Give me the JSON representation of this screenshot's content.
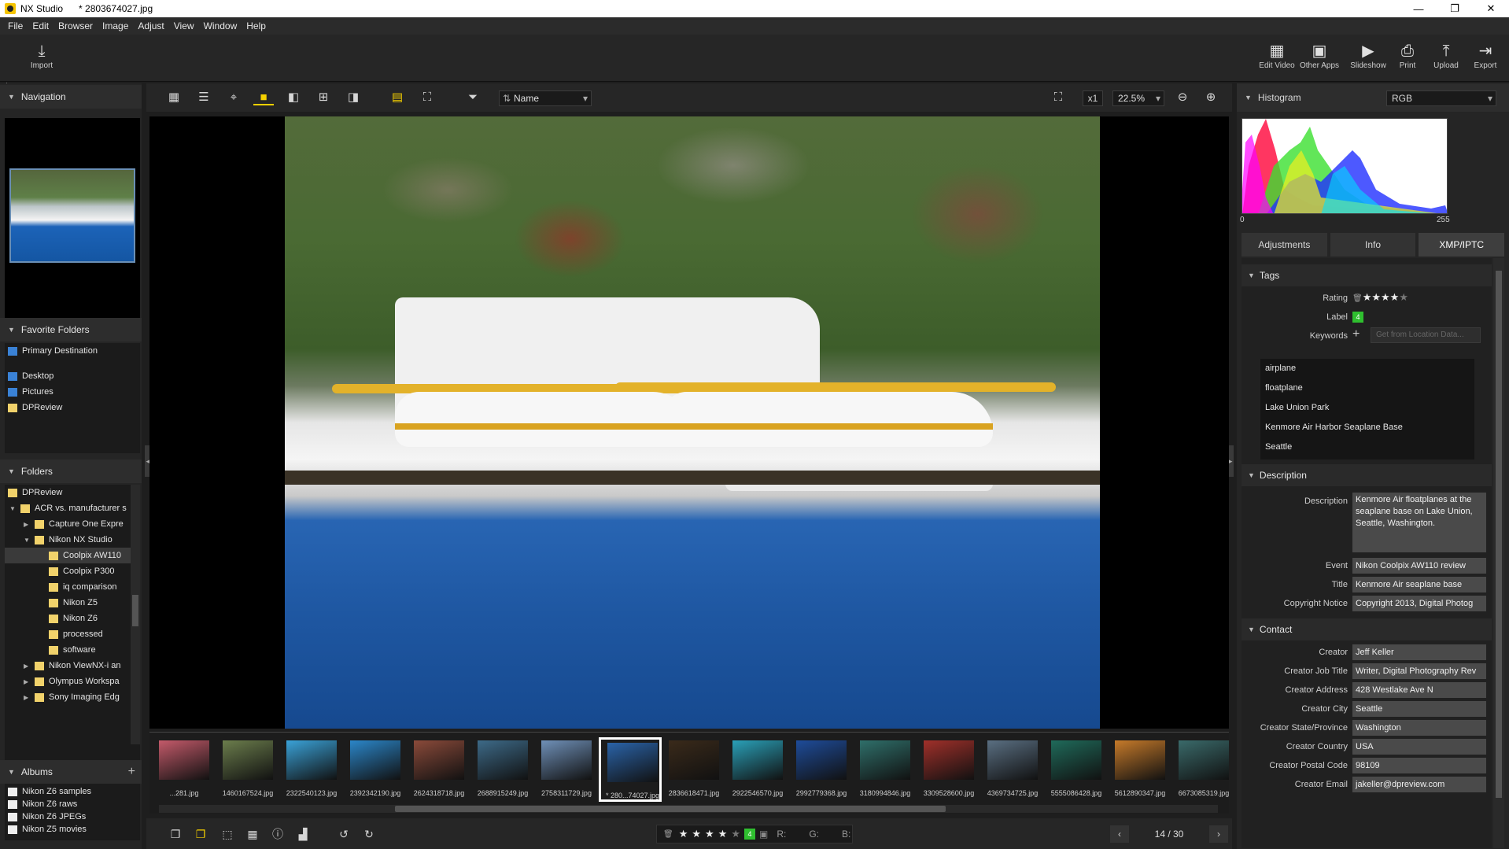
{
  "titlebar": {
    "app": "NX Studio",
    "document": "* 2803674027.jpg",
    "minimize": "—",
    "restore": "❐",
    "close": "✕"
  },
  "menu": [
    "File",
    "Edit",
    "Browser",
    "Image",
    "Adjust",
    "View",
    "Window",
    "Help"
  ],
  "toolbar": {
    "import": "Import",
    "right": [
      "Edit Video",
      "Other Apps",
      "Slideshow",
      "Print",
      "Upload",
      "Export"
    ]
  },
  "navigation": {
    "title": "Navigation"
  },
  "favorites": {
    "title": "Favorite Folders",
    "items": [
      "Primary Destination",
      "Desktop",
      "Pictures",
      "DPReview"
    ]
  },
  "folders": {
    "title": "Folders",
    "items": [
      "DPReview",
      "ACR vs. manufacturer s",
      "Capture One Expre",
      "Nikon NX Studio",
      "Coolpix AW110",
      "Coolpix P300",
      "iq comparison",
      "Nikon Z5",
      "Nikon Z6",
      "processed",
      "software",
      "Nikon ViewNX-i an",
      "Olympus Workspa",
      "Sony Imaging Edg"
    ]
  },
  "albums": {
    "title": "Albums",
    "items": [
      "Nikon Z6 samples",
      "Nikon Z6 raws",
      "Nikon Z6 JPEGs",
      "Nikon Z5 movies"
    ]
  },
  "viewbar": {
    "sort": "Name",
    "x1": "x1",
    "zoom": "22.5%"
  },
  "filmstrip": [
    {
      "name": "...281.jpg",
      "color": "#c45a6a"
    },
    {
      "name": "1460167524.jpg",
      "color": "#6b7d4c"
    },
    {
      "name": "2322540123.jpg",
      "color": "#3aa2d8"
    },
    {
      "name": "2392342190.jpg",
      "color": "#2b86c9"
    },
    {
      "name": "2624318718.jpg",
      "color": "#8a4a3a"
    },
    {
      "name": "2688915249.jpg",
      "color": "#3d6a88"
    },
    {
      "name": "2758311729.jpg",
      "color": "#6f90b8"
    },
    {
      "name": "* 280...74027.jpg",
      "color": "#2a63a8"
    },
    {
      "name": "2836618471.jpg",
      "color": "#3a2a1a"
    },
    {
      "name": "2922546570.jpg",
      "color": "#2aa0b8"
    },
    {
      "name": "2992779368.jpg",
      "color": "#1e4c9a"
    },
    {
      "name": "3180994846.jpg",
      "color": "#2f6f6a"
    },
    {
      "name": "3309528600.jpg",
      "color": "#a0302a"
    },
    {
      "name": "4369734725.jpg",
      "color": "#5a6f82"
    },
    {
      "name": "5555086428.jpg",
      "color": "#1f6a5a"
    },
    {
      "name": "5612890347.jpg",
      "color": "#c67a2a"
    },
    {
      "name": "6673085319.jpg",
      "color": "#3a6a6a"
    }
  ],
  "bottombar": {
    "label_num": "4",
    "r": "R:",
    "g": "G:",
    "b": "B:",
    "page": "14 / 30"
  },
  "histogram": {
    "title": "Histogram",
    "channel": "RGB",
    "min": "0",
    "max": "255"
  },
  "tabs": [
    "Adjustments",
    "Info",
    "XMP/IPTC"
  ],
  "tags": {
    "title": "Tags",
    "rating_label": "Rating",
    "rating": 4,
    "label_label": "Label",
    "label_value": "4",
    "keywords_label": "Keywords",
    "keywords_button": "Get from Location Data...",
    "keywords": [
      "airplane",
      "floatplane",
      "Lake Union Park",
      "Kenmore Air Harbor Seaplane Base",
      "Seattle"
    ]
  },
  "description": {
    "title": "Description",
    "fields": [
      {
        "label": "Description",
        "value": "Kenmore Air floatplanes at the seaplane base on Lake Union, Seattle, Washington."
      },
      {
        "label": "Event",
        "value": "Nikon Coolpix AW110 review"
      },
      {
        "label": "Title",
        "value": "Kenmore Air seaplane base"
      },
      {
        "label": "Copyright Notice",
        "value": "Copyright 2013, Digital Photog"
      }
    ]
  },
  "contact": {
    "title": "Contact",
    "fields": [
      {
        "label": "Creator",
        "value": "Jeff Keller"
      },
      {
        "label": "Creator Job Title",
        "value": "Writer, Digital Photography Rev"
      },
      {
        "label": "Creator Address",
        "value": "428 Westlake Ave N"
      },
      {
        "label": "Creator City",
        "value": "Seattle"
      },
      {
        "label": "Creator State/Province",
        "value": "Washington"
      },
      {
        "label": "Creator Country",
        "value": "USA"
      },
      {
        "label": "Creator Postal Code",
        "value": "98109"
      },
      {
        "label": "Creator Email",
        "value": "jakeller@dpreview.com"
      }
    ]
  }
}
